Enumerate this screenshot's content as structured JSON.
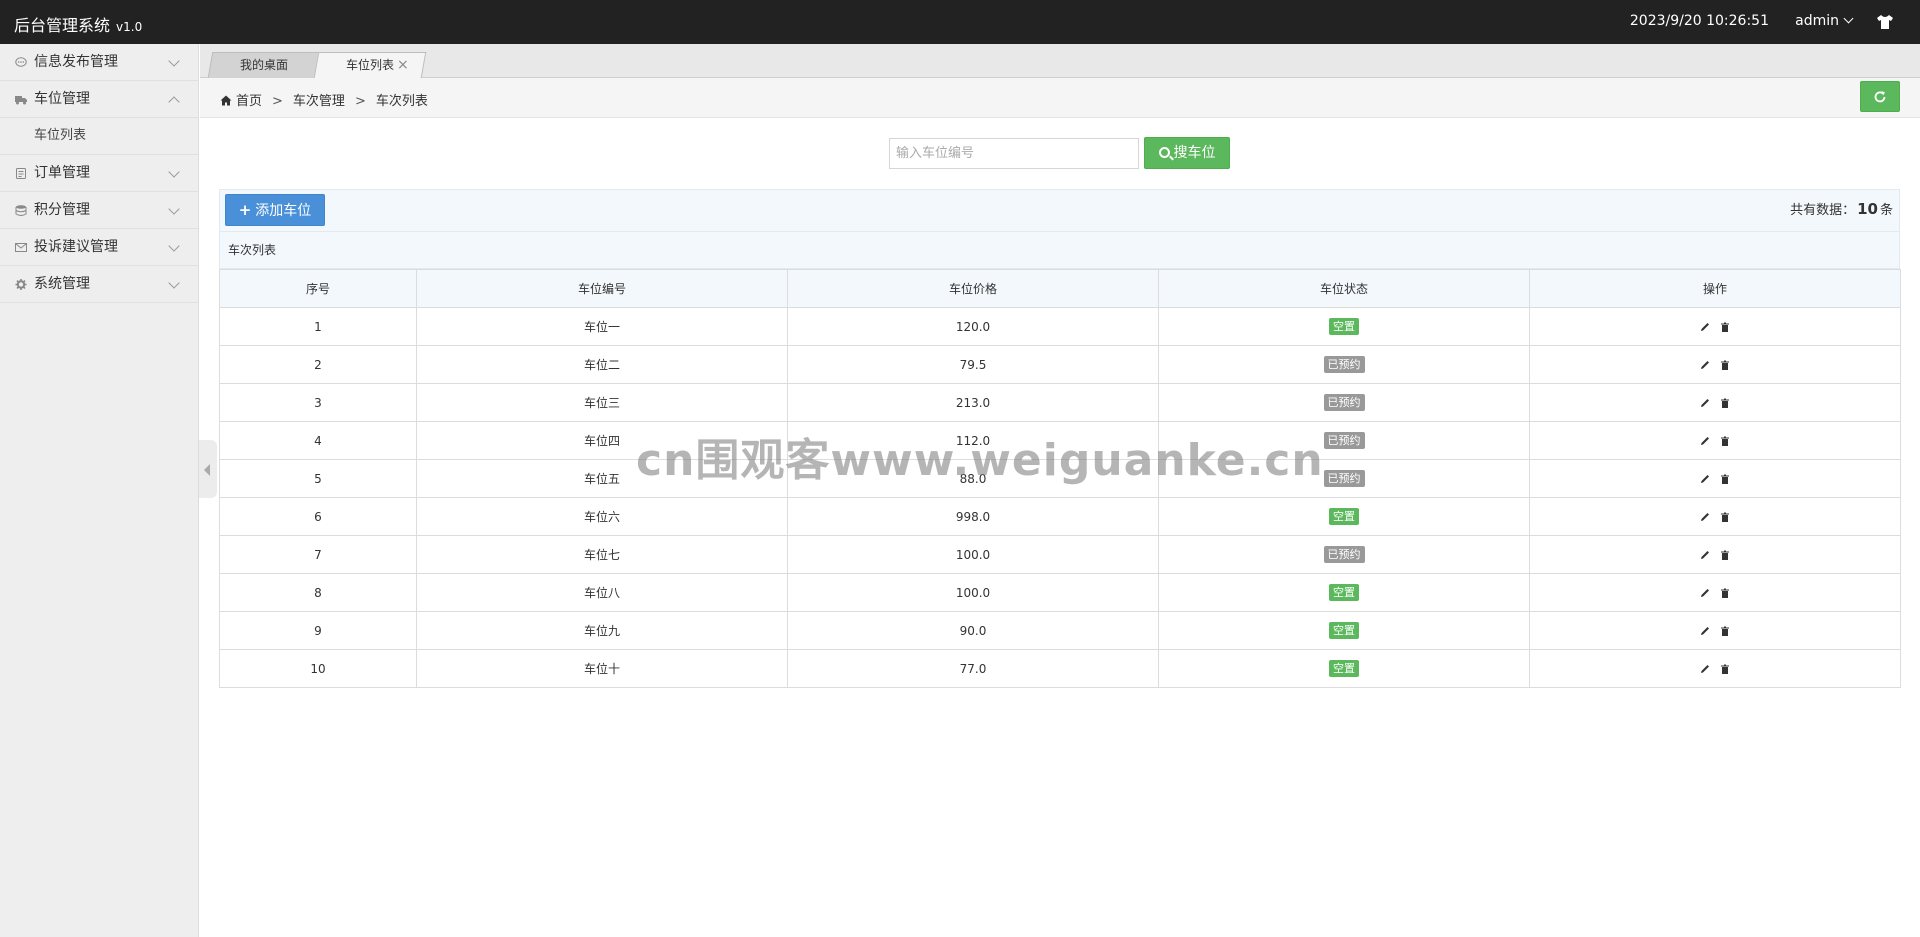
{
  "header": {
    "title": "后台管理系统",
    "version": "v1.0",
    "datetime": "2023/9/20 10:26:51",
    "user": "admin"
  },
  "sidebar": {
    "items": [
      {
        "label": "信息发布管理",
        "icon": "chat-icon",
        "expanded": false
      },
      {
        "label": "车位管理",
        "icon": "truck-icon",
        "expanded": true,
        "children": [
          {
            "label": "车位列表"
          }
        ]
      },
      {
        "label": "订单管理",
        "icon": "order-icon",
        "expanded": false
      },
      {
        "label": "积分管理",
        "icon": "database-icon",
        "expanded": false
      },
      {
        "label": "投诉建议管理",
        "icon": "envelope-icon",
        "expanded": false
      },
      {
        "label": "系统管理",
        "icon": "gear-icon",
        "expanded": false
      }
    ]
  },
  "tabs": [
    {
      "label": "我的桌面",
      "active": false
    },
    {
      "label": "车位列表",
      "active": true,
      "close": "×"
    }
  ],
  "breadcrumb": {
    "home": "首页",
    "separator": ">",
    "level1": "车次管理",
    "level2": "车次列表"
  },
  "search": {
    "placeholder": "输入车位编号",
    "value": "",
    "button_label": "搜车位"
  },
  "toolbar": {
    "add_label": "添加车位",
    "count_prefix": "共有数据：",
    "count_value": "10",
    "count_suffix": "条"
  },
  "table": {
    "caption": "车次列表",
    "columns": [
      "序号",
      "车位编号",
      "车位价格",
      "车位状态",
      "操作"
    ],
    "rows": [
      {
        "no": "1",
        "code": "车位一",
        "price": "120.0",
        "status": "空置",
        "status_type": "free"
      },
      {
        "no": "2",
        "code": "车位二",
        "price": "79.5",
        "status": "已预约",
        "status_type": "booked"
      },
      {
        "no": "3",
        "code": "车位三",
        "price": "213.0",
        "status": "已预约",
        "status_type": "booked"
      },
      {
        "no": "4",
        "code": "车位四",
        "price": "112.0",
        "status": "已预约",
        "status_type": "booked"
      },
      {
        "no": "5",
        "code": "车位五",
        "price": "88.0",
        "status": "已预约",
        "status_type": "booked"
      },
      {
        "no": "6",
        "code": "车位六",
        "price": "998.0",
        "status": "空置",
        "status_type": "free"
      },
      {
        "no": "7",
        "code": "车位七",
        "price": "100.0",
        "status": "已预约",
        "status_type": "booked"
      },
      {
        "no": "8",
        "code": "车位八",
        "price": "100.0",
        "status": "空置",
        "status_type": "free"
      },
      {
        "no": "9",
        "code": "车位九",
        "price": "90.0",
        "status": "空置",
        "status_type": "free"
      },
      {
        "no": "10",
        "code": "车位十",
        "price": "77.0",
        "status": "空置",
        "status_type": "free"
      }
    ]
  },
  "watermark": "cn围观客www.weiguanke.cn",
  "colors": {
    "topbar": "#222222",
    "success": "#5cb85c",
    "primary": "#4a90d9",
    "booked": "#999999"
  }
}
